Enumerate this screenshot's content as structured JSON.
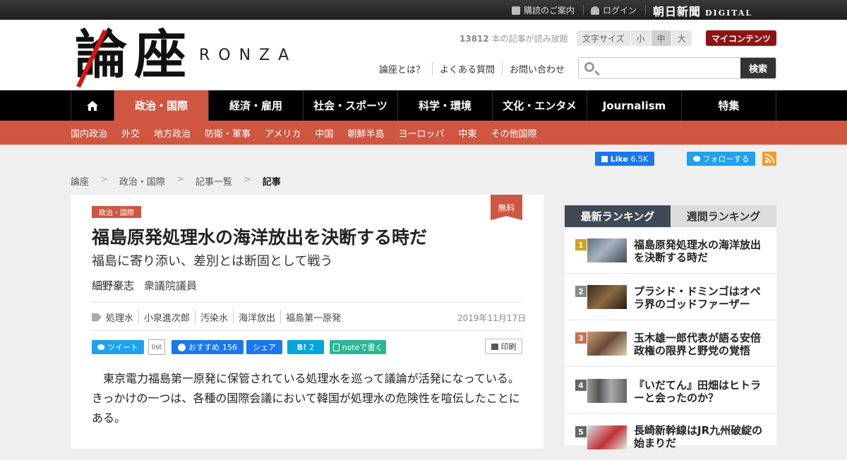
{
  "topbar": {
    "guide": "購読のご案内",
    "login": "ログイン",
    "brand": "朝日新聞",
    "brand_sub": "DIGITAL"
  },
  "header": {
    "logo_chars": [
      "論",
      "座"
    ],
    "logo_latin": "RONZA",
    "read_count": "13812",
    "read_suffix": "本の記事が読み放題",
    "font_size_label": "文字サイズ",
    "font_sizes": [
      "小",
      "中",
      "大"
    ],
    "font_size_selected": "中",
    "my_contents": "マイコンテンツ",
    "links": [
      "論座とは？",
      "よくある質問",
      "お問い合わせ"
    ],
    "search_placeholder": "",
    "search_button": "検索"
  },
  "nav": {
    "home_icon": "home-icon",
    "tabs": [
      "政治・国際",
      "経済・雇用",
      "社会・スポーツ",
      "科学・環境",
      "文化・エンタメ",
      "Journalism",
      "特集"
    ],
    "active_tab": "政治・国際",
    "subtabs": [
      "国内政治",
      "外交",
      "地方政治",
      "防衛・軍事",
      "アメリカ",
      "中国",
      "朝鮮半島",
      "ヨーロッパ",
      "中東",
      "その他国際"
    ]
  },
  "social": {
    "fb_like": "Like",
    "fb_count": "6.5K",
    "tw_follow": "フォローする"
  },
  "breadcrumb": [
    "論座",
    "政治・国際",
    "記事一覧",
    "記事"
  ],
  "article": {
    "category": "政治・国際",
    "free_badge": "無料",
    "title": "福島原発処理水の海洋放出を決断する時だ",
    "subtitle": "福島に寄り添い、差別とは断固として戦う",
    "author": "細野豪志",
    "author_role": "衆議院議員",
    "tags": [
      "処理水",
      "小泉進次郎",
      "汚染水",
      "海洋放出",
      "福島第一原発"
    ],
    "date": "2019年11月17日",
    "share": {
      "tweet": "ツイート",
      "list": "list",
      "fb_recommend": "おすすめ",
      "fb_count": "156",
      "fb_share": "シェア",
      "hatena": "B!",
      "hatena_count": "2",
      "note": "noteで書く",
      "print": "印刷"
    },
    "body": "東京電力福島第一原発に保管されている処理水を巡って議論が活発になっている。きっかけの一つは、各種の国際会議において韓国が処理水の危険性を喧伝したことにある。"
  },
  "ranking": {
    "tabs": [
      "最新ランキング",
      "週間ランキング"
    ],
    "active_tab": "最新ランキング",
    "items": [
      {
        "rank": "1",
        "title": "福島原発処理水の海洋放出を決断する時だ",
        "color": "#d4a017"
      },
      {
        "rank": "2",
        "title": "プラシド・ドミンゴはオペラ界のゴッドファーザー",
        "color": "#888888"
      },
      {
        "rank": "3",
        "title": "玉木雄一郎代表が語る安倍政権の限界と野党の覚悟",
        "color": "#c87050"
      },
      {
        "rank": "4",
        "title": "『いだてん』田畑はヒトラーと会ったのか？",
        "color": "#666666"
      },
      {
        "rank": "5",
        "title": "長崎新幹線はJR九州破綻の始まりだ",
        "color": "#666666"
      }
    ]
  }
}
